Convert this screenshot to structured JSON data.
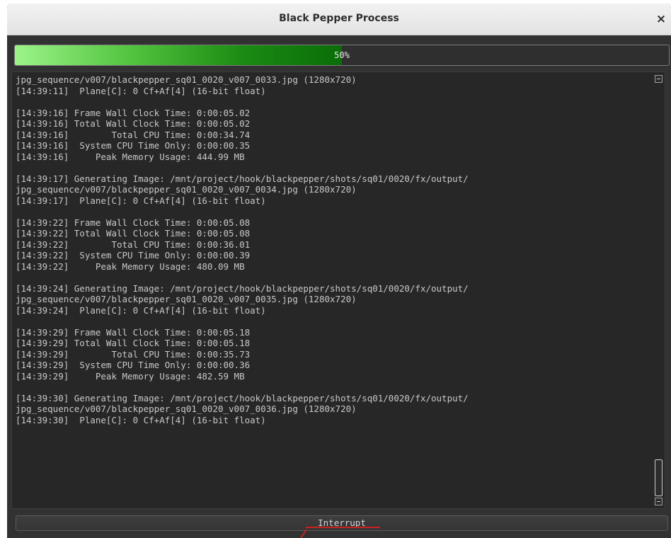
{
  "window": {
    "title": "Black Pepper Process",
    "close_label": "×"
  },
  "progress": {
    "value": 0.5,
    "text": "50%"
  },
  "log": {
    "lines": [
      "jpg_sequence/v007/blackpepper_sq01_0020_v007_0033.jpg (1280x720)",
      "[14:39:11]  Plane[C]: 0 Cf+Af[4] (16-bit float)",
      "",
      "[14:39:16] Frame Wall Clock Time: 0:00:05.02",
      "[14:39:16] Total Wall Clock Time: 0:00:05.02",
      "[14:39:16]        Total CPU Time: 0:00:34.74",
      "[14:39:16]  System CPU Time Only: 0:00:00.35",
      "[14:39:16]     Peak Memory Usage: 444.99 MB",
      "",
      "[14:39:17] Generating Image: /mnt/project/hook/blackpepper/shots/sq01/0020/fx/output/",
      "jpg_sequence/v007/blackpepper_sq01_0020_v007_0034.jpg (1280x720)",
      "[14:39:17]  Plane[C]: 0 Cf+Af[4] (16-bit float)",
      "",
      "[14:39:22] Frame Wall Clock Time: 0:00:05.08",
      "[14:39:22] Total Wall Clock Time: 0:00:05.08",
      "[14:39:22]        Total CPU Time: 0:00:36.01",
      "[14:39:22]  System CPU Time Only: 0:00:00.39",
      "[14:39:22]     Peak Memory Usage: 480.09 MB",
      "",
      "[14:39:24] Generating Image: /mnt/project/hook/blackpepper/shots/sq01/0020/fx/output/",
      "jpg_sequence/v007/blackpepper_sq01_0020_v007_0035.jpg (1280x720)",
      "[14:39:24]  Plane[C]: 0 Cf+Af[4] (16-bit float)",
      "",
      "[14:39:29] Frame Wall Clock Time: 0:00:05.18",
      "[14:39:29] Total Wall Clock Time: 0:00:05.18",
      "[14:39:29]        Total CPU Time: 0:00:35.73",
      "[14:39:29]  System CPU Time Only: 0:00:00.36",
      "[14:39:29]     Peak Memory Usage: 482.59 MB",
      "",
      "[14:39:30] Generating Image: /mnt/project/hook/blackpepper/shots/sq01/0020/fx/output/",
      "jpg_sequence/v007/blackpepper_sq01_0020_v007_0036.jpg (1280x720)",
      "[14:39:30]  Plane[C]: 0 Cf+Af[4] (16-bit float)"
    ]
  },
  "buttons": {
    "interrupt_label": "Interrupt"
  },
  "colors": {
    "progress_start": "#9cf489",
    "progress_end": "#0b6d08",
    "annotation": "#cc2020"
  },
  "icons": {
    "scroll_up": "scroll-up-arrow-icon",
    "scroll_down": "scroll-down-arrow-icon",
    "close": "close-icon"
  }
}
